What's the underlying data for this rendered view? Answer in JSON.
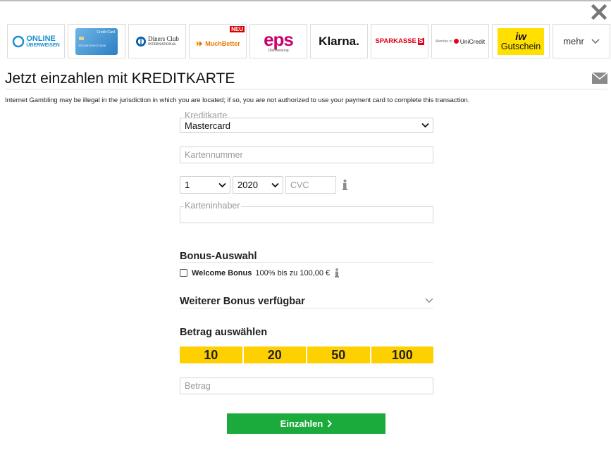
{
  "header": {
    "methods": [
      {
        "name": "online-ueberweisen",
        "line1": "ONLINE",
        "line2": "ÜBERWEISEN"
      },
      {
        "name": "credit-card",
        "label": "Credit Card",
        "card_number": "1234 5678 9012 3456"
      },
      {
        "name": "diners-club",
        "line1": "Diners Club",
        "line2": "INTERNATIONAL"
      },
      {
        "name": "muchbetter",
        "label": "MuchBetter",
        "badge": "NEU"
      },
      {
        "name": "eps",
        "label": "eps",
        "sub": "Überweisung"
      },
      {
        "name": "klarna",
        "label": "Klarna."
      },
      {
        "name": "sparkasse",
        "label": "SPARKASSE"
      },
      {
        "name": "unicredit",
        "prefix": "Member of",
        "label": "UniCredit"
      },
      {
        "name": "iw-gutschein",
        "line1": "iw",
        "line2": "Gutschein"
      }
    ],
    "more_label": "mehr"
  },
  "page": {
    "title": "Jetzt einzahlen mit KREDITKARTE",
    "disclaimer": "Internet Gambling may be illegal in the jurisdiction in which you are located; if so, you are not authorized to use your payment card to complete this transaction."
  },
  "form": {
    "card_type": {
      "legend": "Kreditkarte",
      "value": "Mastercard"
    },
    "card_number": {
      "placeholder": "Kartennummer"
    },
    "expiry_month": {
      "value": "1"
    },
    "expiry_year": {
      "value": "2020"
    },
    "cvc": {
      "placeholder": "CVC"
    },
    "card_holder": {
      "legend": "Karteninhaber"
    }
  },
  "bonus": {
    "heading": "Bonus-Auswahl",
    "welcome_label": "Welcome Bonus",
    "welcome_desc": "100% bis zu 100,00 €",
    "welcome_checked": false,
    "more_heading": "Weiterer Bonus verfügbar"
  },
  "amount": {
    "heading": "Betrag auswählen",
    "options": [
      "10",
      "20",
      "50",
      "100"
    ],
    "placeholder": "Betrag"
  },
  "submit_label": "Einzahlen",
  "colors": {
    "accent_yellow": "#ffd000",
    "submit_green": "#1aab3c",
    "eps_pink": "#c8036f",
    "sparkasse_red": "#e2001a",
    "unicredit_red": "#e3001b"
  }
}
